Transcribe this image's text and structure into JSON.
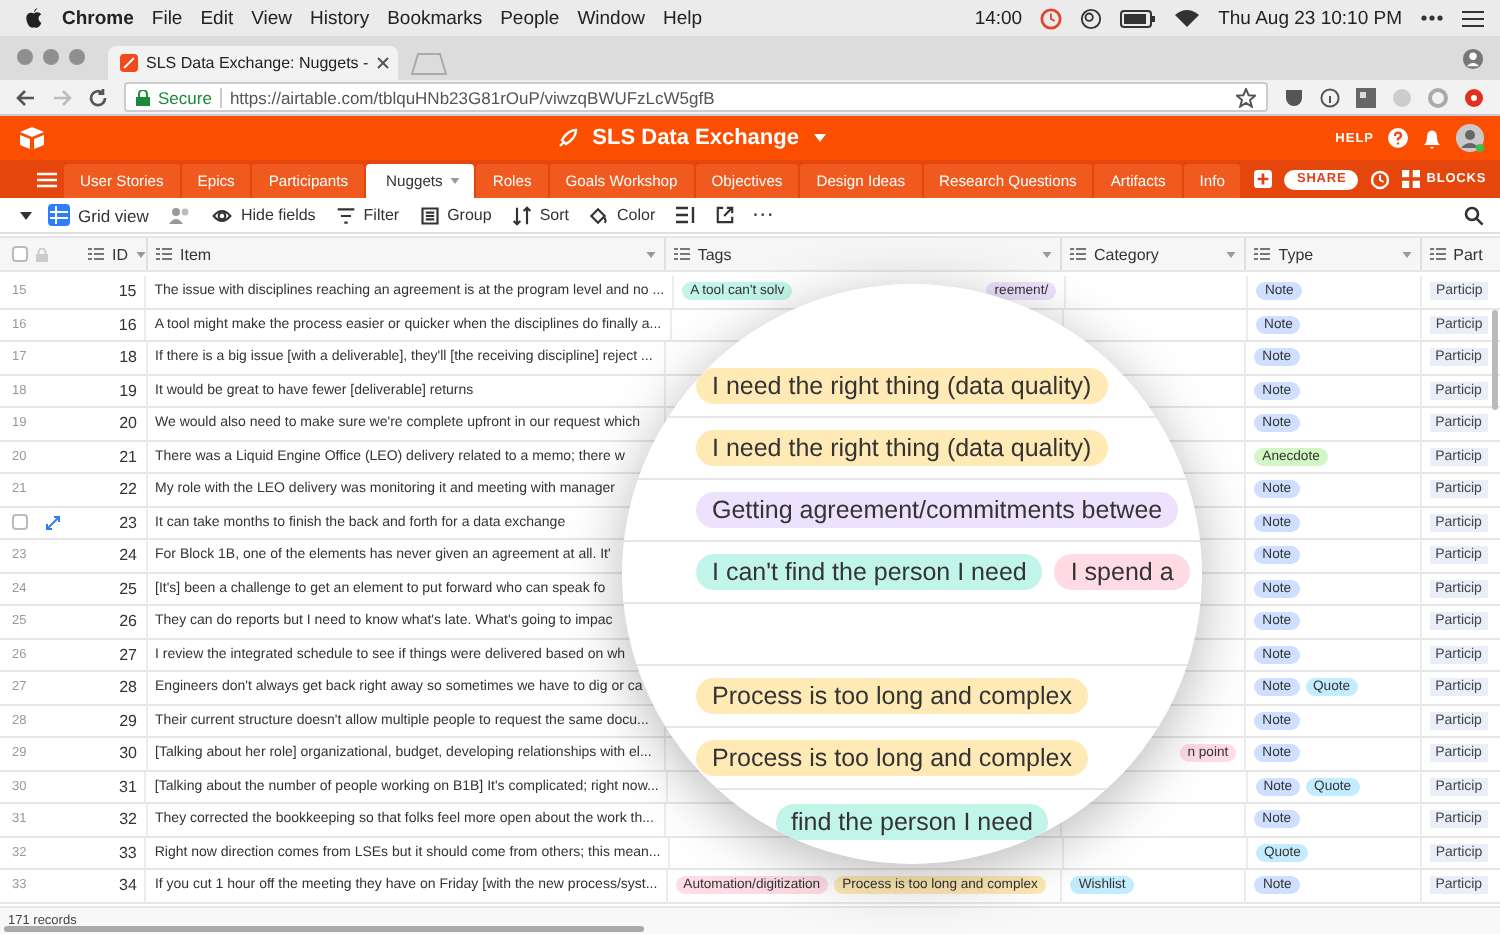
{
  "menubar": {
    "app": "Chrome",
    "menus": [
      "File",
      "Edit",
      "View",
      "History",
      "Bookmarks",
      "People",
      "Window",
      "Help"
    ],
    "time_left": "14:00",
    "clock": "Thu Aug 23  10:10 PM"
  },
  "browser": {
    "tab_title": "SLS Data Exchange: Nuggets -",
    "secure_label": "Secure",
    "url": "https://airtable.com/tblquHNb23G81rOuP/viwzqBWUFzLcW5gfB"
  },
  "base": {
    "title": "SLS Data Exchange",
    "help": "HELP",
    "share": "SHARE",
    "blocks": "BLOCKS"
  },
  "tabs": [
    {
      "label": "User Stories",
      "selected": false
    },
    {
      "label": "Epics",
      "selected": false
    },
    {
      "label": "Participants",
      "selected": false
    },
    {
      "label": "Nuggets",
      "selected": true
    },
    {
      "label": "Roles",
      "selected": false
    },
    {
      "label": "Goals Workshop",
      "selected": false
    },
    {
      "label": "Objectives",
      "selected": false
    },
    {
      "label": "Design Ideas",
      "selected": false
    },
    {
      "label": "Research Questions",
      "selected": false
    },
    {
      "label": "Artifacts",
      "selected": false
    },
    {
      "label": "Info",
      "selected": false
    }
  ],
  "toolbar": {
    "view": "Grid view",
    "actions": [
      {
        "kind": "eye",
        "label": "Hide fields"
      },
      {
        "kind": "filter",
        "label": "Filter"
      },
      {
        "kind": "group",
        "label": "Group"
      },
      {
        "kind": "sort",
        "label": "Sort"
      },
      {
        "kind": "color",
        "label": "Color"
      }
    ],
    "more": "···"
  },
  "table": {
    "select_all_checked": false,
    "columns": [
      {
        "label": "ID"
      },
      {
        "label": "Item"
      },
      {
        "label": "Tags"
      },
      {
        "label": "Category"
      },
      {
        "label": "Type"
      },
      {
        "label": "Part"
      }
    ],
    "rows": [
      {
        "row": "15",
        "id": "15",
        "item": "The issue with disciplines reaching an agreement is at the program level and no ...",
        "tags": [
          {
            "label": "A tool can't solv",
            "color": "#c2f5e9"
          },
          {
            "label": "reement/",
            "color": "#ede2fe"
          }
        ],
        "type": [
          {
            "label": "Note",
            "color": "#cfdfff"
          }
        ],
        "part": "Particip"
      },
      {
        "row": "16",
        "id": "16",
        "item": "A tool might make the process easier or quicker when the disciplines do finally a...",
        "type": [
          {
            "label": "Note",
            "color": "#cfdfff"
          }
        ],
        "part": "Particip"
      },
      {
        "row": "17",
        "id": "18",
        "item": "If there is a big issue [with a deliverable], they'll [the receiving discipline] reject ...",
        "type": [
          {
            "label": "Note",
            "color": "#cfdfff"
          }
        ],
        "part": "Particip"
      },
      {
        "row": "18",
        "id": "19",
        "item": "It would be great to have fewer [deliverable] returns",
        "type": [
          {
            "label": "Note",
            "color": "#cfdfff"
          }
        ],
        "part": "Particip"
      },
      {
        "row": "19",
        "id": "20",
        "item": "We would also need to make sure we're complete upfront in our request which",
        "type": [
          {
            "label": "Note",
            "color": "#cfdfff"
          }
        ],
        "part": "Particip"
      },
      {
        "row": "20",
        "id": "21",
        "item": "There was a Liquid Engine Office (LEO) delivery related to a memo; there w",
        "type": [
          {
            "label": "Anecdote",
            "color": "#d1f7c4"
          }
        ],
        "part": "Particip"
      },
      {
        "row": "21",
        "id": "22",
        "item": "My role with the LEO delivery was monitoring it and meeting with manager",
        "type": [
          {
            "label": "Note",
            "color": "#cfdfff"
          }
        ],
        "part": "Particip"
      },
      {
        "hovered": true,
        "checked": false,
        "id": "23",
        "item": "It can take months to finish the back and forth for a data exchange",
        "type": [
          {
            "label": "Note",
            "color": "#cfdfff"
          }
        ],
        "part": "Particip"
      },
      {
        "row": "23",
        "id": "24",
        "item": "For Block 1B, one of the elements has never given an agreement at all. It'",
        "type": [
          {
            "label": "Note",
            "color": "#cfdfff"
          }
        ],
        "part": "Particip"
      },
      {
        "row": "24",
        "id": "25",
        "item": "[It's] been a challenge to get an element to put forward who can speak fo",
        "type": [
          {
            "label": "Note",
            "color": "#cfdfff"
          }
        ],
        "part": "Particip"
      },
      {
        "row": "25",
        "id": "26",
        "item": "They can do reports but I need to know what's late. What's going to impac",
        "type": [
          {
            "label": "Note",
            "color": "#cfdfff"
          }
        ],
        "part": "Particip"
      },
      {
        "row": "26",
        "id": "27",
        "item": "I review the integrated schedule to see if things were delivered based on wh",
        "type": [
          {
            "label": "Note",
            "color": "#cfdfff"
          }
        ],
        "part": "Particip"
      },
      {
        "row": "27",
        "id": "28",
        "item": "Engineers don't always get back right away so sometimes we have to dig or ca",
        "type": [
          {
            "label": "Note",
            "color": "#cfdfff"
          },
          {
            "label": "Quote",
            "color": "#c4ecff"
          }
        ],
        "part": "Particip"
      },
      {
        "row": "28",
        "id": "29",
        "item": "Their current structure doesn't allow multiple people to request the same docu...",
        "type": [
          {
            "label": "Note",
            "color": "#cfdfff"
          }
        ],
        "part": "Particip"
      },
      {
        "row": "29",
        "id": "30",
        "item": "[Talking about her role] organizational, budget, developing relationships with el...",
        "category": [
          {
            "label": "n point",
            "color": "#ffdce5"
          }
        ],
        "type": [
          {
            "label": "Note",
            "color": "#cfdfff"
          }
        ],
        "part": "Particip"
      },
      {
        "row": "30",
        "id": "31",
        "item": "[Talking about the number of people working on B1B] It's complicated; right now...",
        "type": [
          {
            "label": "Note",
            "color": "#cfdfff"
          },
          {
            "label": "Quote",
            "color": "#c4ecff"
          }
        ],
        "part": "Particip"
      },
      {
        "row": "31",
        "id": "32",
        "item": "They corrected the bookkeeping so that folks feel more open about the work th...",
        "type": [
          {
            "label": "Note",
            "color": "#cfdfff"
          }
        ],
        "part": "Particip"
      },
      {
        "row": "32",
        "id": "33",
        "item": "Right now direction comes from LSEs but it should come from others; this mean...",
        "type": [
          {
            "label": "Quote",
            "color": "#c4ecff"
          }
        ],
        "part": "Particip"
      },
      {
        "row": "33",
        "id": "34",
        "item": "If you cut 1 hour off the meeting they have on Friday [with the new process/syst...",
        "tags": [
          {
            "label": "Automation/digitization",
            "color": "#ffdce5"
          },
          {
            "label": "Process is too long and complex",
            "color": "#ffeab6"
          }
        ],
        "category": [
          {
            "label": "Wishlist",
            "color": "#c4ecff"
          }
        ],
        "type": [
          {
            "label": "Note",
            "color": "#cfdfff"
          }
        ],
        "part": "Particip"
      }
    ],
    "record_count": "171 records"
  },
  "magnifier": {
    "rows": [
      {
        "tags": [
          {
            "label": "I need the right thing (data quality)",
            "color": "#ffeab6"
          }
        ]
      },
      {
        "tags": [
          {
            "label": "I need the right thing (data quality)",
            "color": "#ffeab6"
          }
        ]
      },
      {
        "tags": [
          {
            "label": "Getting agreement/commitments betwee",
            "color": "#ede2fe"
          }
        ]
      },
      {
        "tags": [
          {
            "label": "I can't find the person I need",
            "color": "#c2f5e9"
          },
          {
            "label": "I spend a",
            "color": "#ffdce5"
          }
        ]
      },
      {
        "tags": []
      },
      {
        "tags": [
          {
            "label": "Process is too long and complex",
            "color": "#ffeab6"
          }
        ]
      },
      {
        "tags": [
          {
            "label": "Process is too long and complex",
            "color": "#ffeab6"
          }
        ]
      },
      {
        "tags": [
          {
            "label": "find the person I need",
            "color": "#c2f5e9"
          }
        ]
      }
    ]
  }
}
